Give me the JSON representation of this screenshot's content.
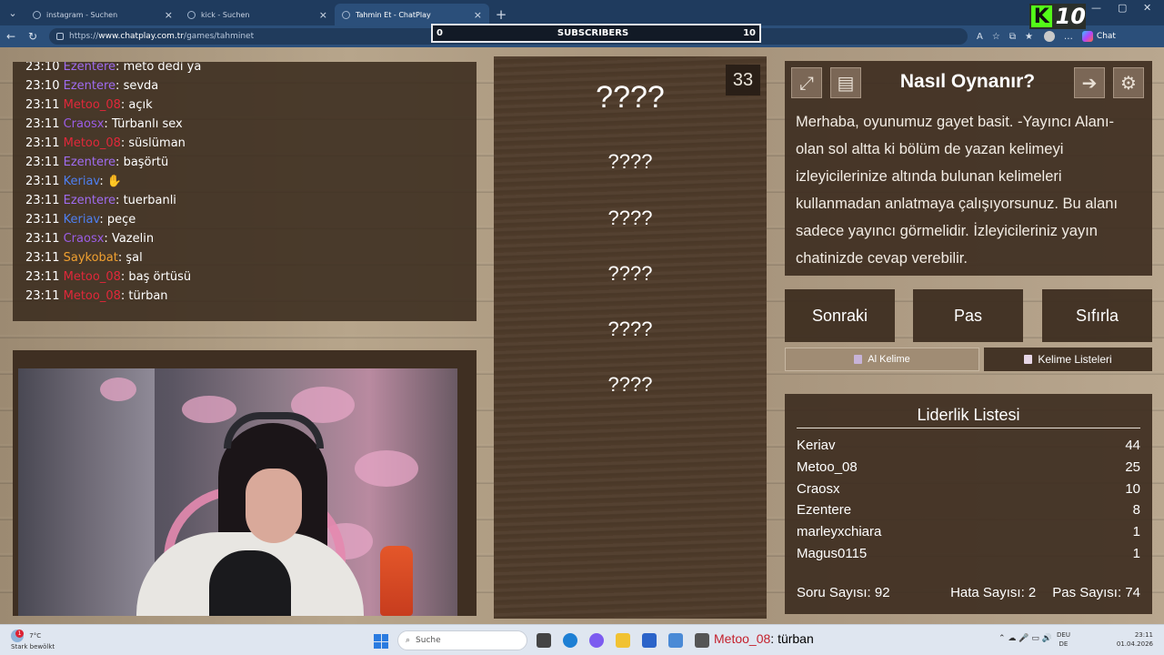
{
  "browser": {
    "tabs": [
      {
        "title": "instagram - Suchen",
        "active": false
      },
      {
        "title": "kick - Suchen",
        "active": false
      },
      {
        "title": "Tahmin Et - ChatPlay",
        "active": true
      }
    ],
    "url_prefix": "https://",
    "url_host": "www.chatplay.com.tr",
    "url_path": "/games/tahminet",
    "chat_button": "Chat"
  },
  "subscribers": {
    "left_value": "0",
    "label": "SUBSCRIBERS",
    "right_value": "10"
  },
  "kick_badge": {
    "letter": "K",
    "count": "10",
    "color": "#53fc18"
  },
  "chat": {
    "messages": [
      {
        "time": "23:10",
        "user": "Ezentere",
        "color": "#a06cf0",
        "text": "meto dedi ya"
      },
      {
        "time": "23:10",
        "user": "Ezentere",
        "color": "#a06cf0",
        "text": "sevda"
      },
      {
        "time": "23:11",
        "user": "Metoo_08",
        "color": "#e0283a",
        "text": "açık"
      },
      {
        "time": "23:11",
        "user": "Craosx",
        "color": "#9b5de5",
        "text": "Türbanlı sex"
      },
      {
        "time": "23:11",
        "user": "Metoo_08",
        "color": "#e0283a",
        "text": "süslüman"
      },
      {
        "time": "23:11",
        "user": "Ezentere",
        "color": "#a06cf0",
        "text": "başörtü"
      },
      {
        "time": "23:11",
        "user": "Keriav",
        "color": "#4f7ff0",
        "text": "✋"
      },
      {
        "time": "23:11",
        "user": "Ezentere",
        "color": "#a06cf0",
        "text": "tuerbanli"
      },
      {
        "time": "23:11",
        "user": "Keriav",
        "color": "#4f7ff0",
        "text": "peçe"
      },
      {
        "time": "23:11",
        "user": "Craosx",
        "color": "#9b5de5",
        "text": "Vazelin"
      },
      {
        "time": "23:11",
        "user": "Saykobat",
        "color": "#f0a030",
        "text": "şal"
      },
      {
        "time": "23:11",
        "user": "Metoo_08",
        "color": "#e0283a",
        "text": "baş örtüsü"
      },
      {
        "time": "23:11",
        "user": "Metoo_08",
        "color": "#e0283a",
        "text": "türban"
      }
    ]
  },
  "game": {
    "timer": "33",
    "words": [
      "????",
      "????",
      "????",
      "????",
      "????",
      "????"
    ]
  },
  "howto": {
    "title": "Nasıl Oynanır?",
    "body": "Merhaba, oyunumuz gayet basit. -Yayıncı Alanı- olan sol altta ki bölüm de yazan kelimeyi izleyicilerinize altında bulunan kelimeleri kullanmadan anlatmaya çalışıyorsunuz. Bu alanı sadece yayıncı görmelidir. İzleyicileriniz yayın chatinizde cevap verebilir."
  },
  "controls": {
    "next": "Sonraki",
    "pass": "Pas",
    "reset": "Sıfırla",
    "get_word": "Al Kelime",
    "word_lists": "Kelime Listeleri"
  },
  "leaderboard": {
    "title": "Liderlik Listesi",
    "rows": [
      {
        "name": "Keriav",
        "score": "44"
      },
      {
        "name": "Metoo_08",
        "score": "25"
      },
      {
        "name": "Craosx",
        "score": "10"
      },
      {
        "name": "Ezentere",
        "score": "8"
      },
      {
        "name": "marleyxchiara",
        "score": "1"
      },
      {
        "name": "Magus0115",
        "score": "1"
      }
    ],
    "question_count_label": "Soru Sayısı: 92",
    "error_count_label": "Hata Sayısı: 2",
    "pass_count_label": "Pas Sayısı: 74"
  },
  "taskbar": {
    "weather_temp": "7°C",
    "weather_desc": "Stark bewölkt",
    "weather_alert": "1",
    "search_placeholder": "Suche",
    "overlay_user": "Metoo_08",
    "overlay_text": "türban",
    "lang_top": "DEU",
    "lang_bottom": "DE",
    "time": "23:11",
    "date": "01.04.2026"
  }
}
